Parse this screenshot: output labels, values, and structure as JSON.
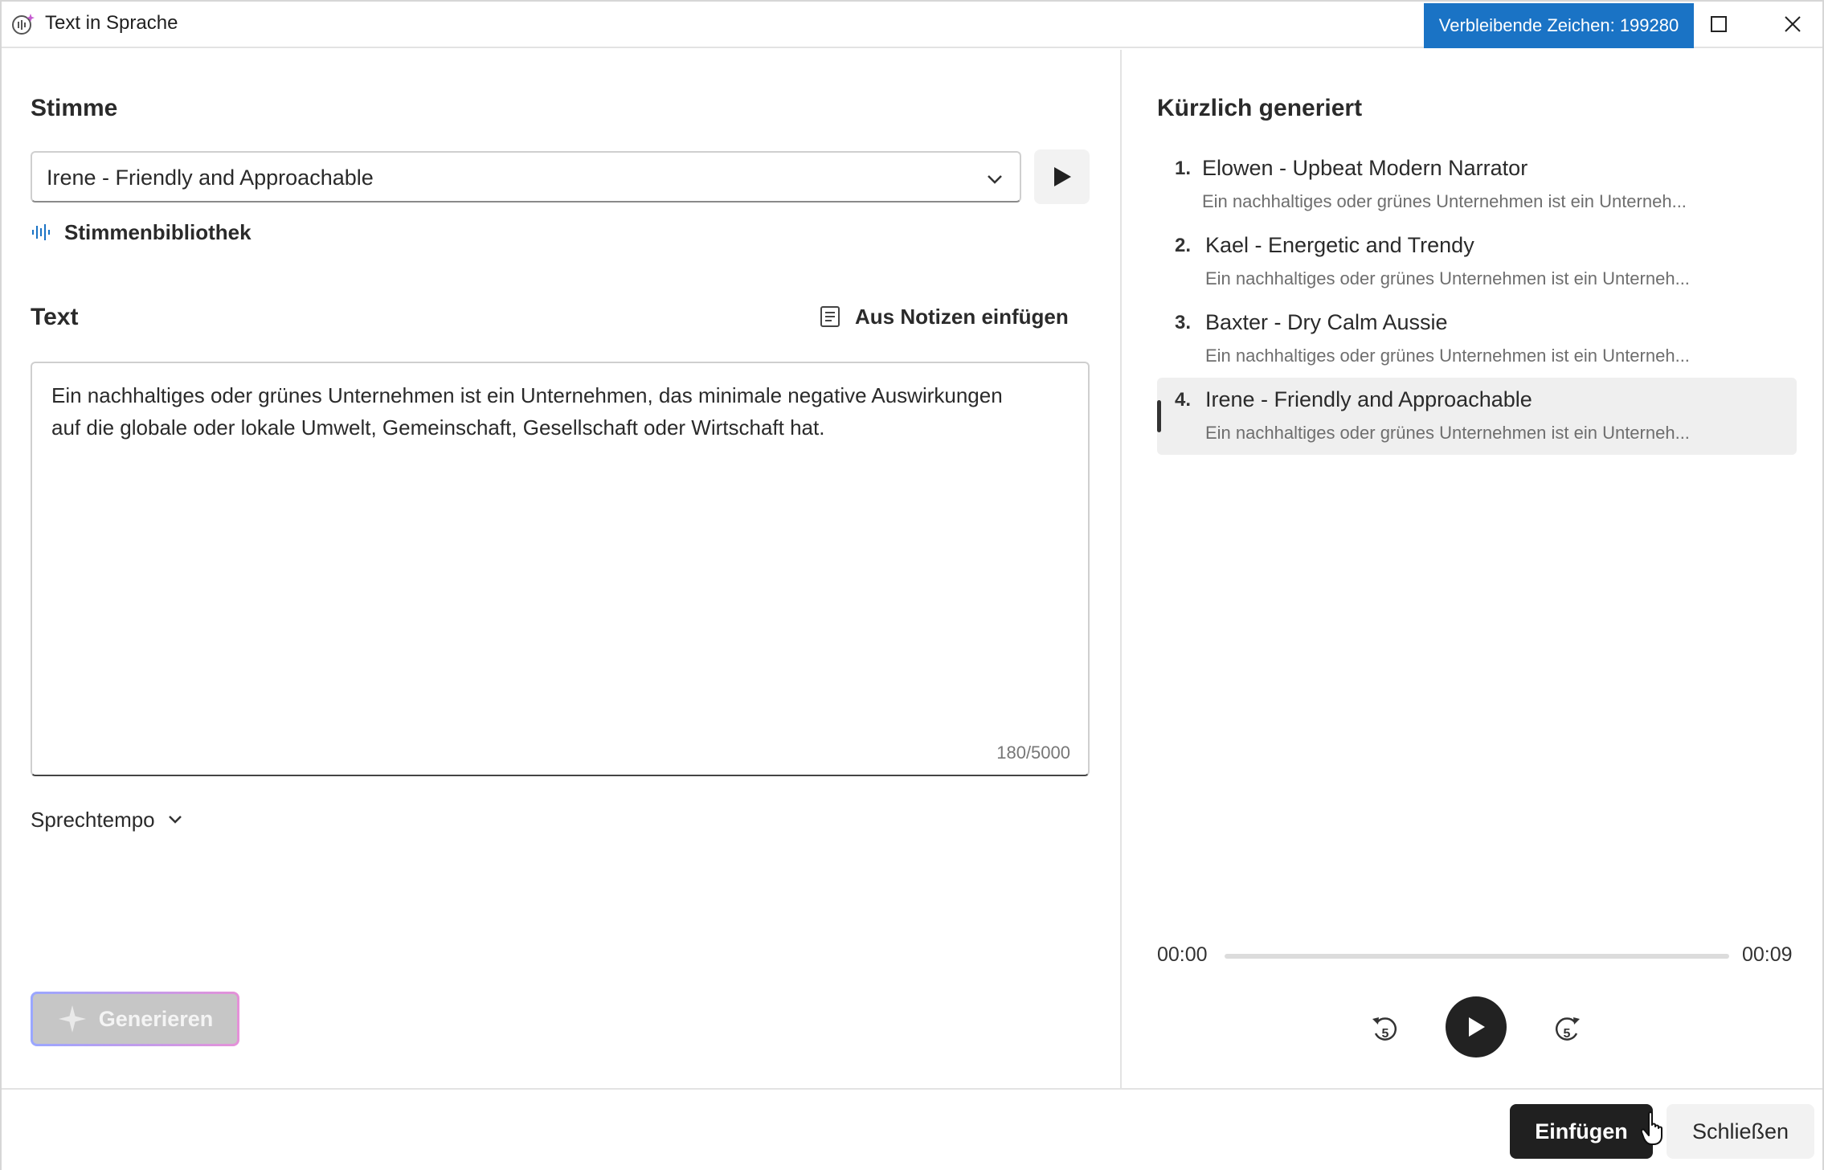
{
  "window": {
    "title": "Text in Sprache",
    "remaining_chars": "Verbleibende Zeichen: 199280"
  },
  "voice": {
    "section_title": "Stimme",
    "selected": "Irene - Friendly and Approachable",
    "library_label": "Stimmenbibliothek"
  },
  "text": {
    "section_title": "Text",
    "insert_notes_label": "Aus Notizen einfügen",
    "content": "Ein nachhaltiges oder grünes Unternehmen ist ein Unternehmen, das minimale negative Auswirkungen auf die globale oder lokale Umwelt, Gemeinschaft, Gesellschaft oder Wirtschaft hat.",
    "char_count": "180/5000"
  },
  "tempo": {
    "label": "Sprechtempo"
  },
  "generate": {
    "label": "Generieren"
  },
  "recent": {
    "section_title": "Kürzlich generiert",
    "items": [
      {
        "num": "1.",
        "name": "Elowen - Upbeat Modern Narrator",
        "sub": "Ein nachhaltiges oder grünes Unternehmen ist ein Unterneh..."
      },
      {
        "num": "2.",
        "name": "Kael - Energetic and Trendy",
        "sub": "Ein nachhaltiges oder grünes Unternehmen ist ein Unterneh..."
      },
      {
        "num": "3.",
        "name": "Baxter - Dry Calm Aussie",
        "sub": "Ein nachhaltiges oder grünes Unternehmen ist ein Unterneh..."
      },
      {
        "num": "4.",
        "name": "Irene - Friendly and Approachable",
        "sub": "Ein nachhaltiges oder grünes Unternehmen ist ein Unterneh..."
      }
    ],
    "active_index": 3
  },
  "player": {
    "time_current": "00:00",
    "time_total": "00:09",
    "progress": 0,
    "skip_seconds": "5"
  },
  "footer": {
    "insert_label": "Einfügen",
    "close_label": "Schließen"
  },
  "colors": {
    "accent": "#1a73c5",
    "primary_button": "#202020"
  }
}
